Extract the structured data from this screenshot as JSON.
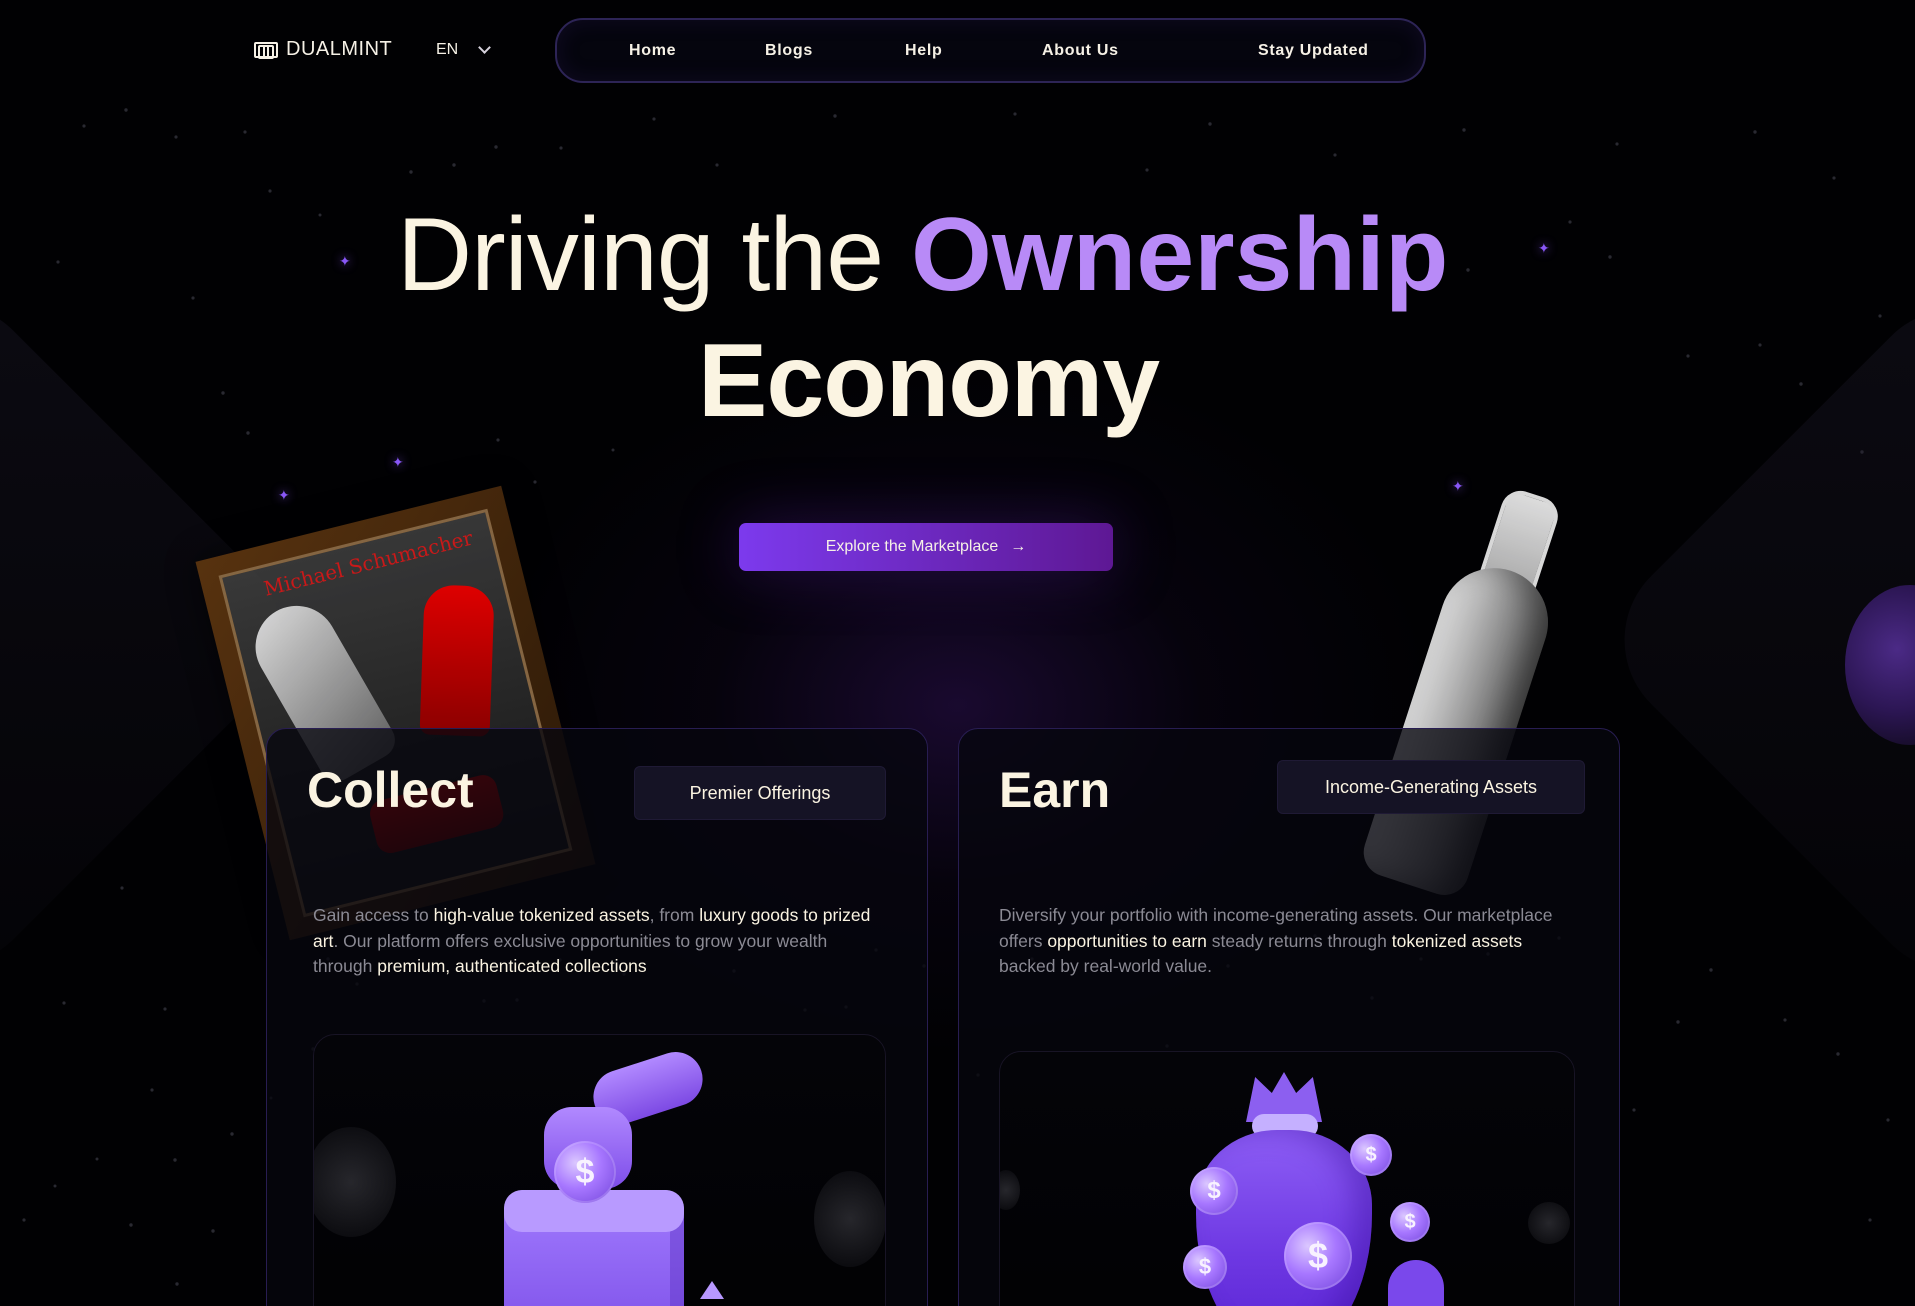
{
  "brand": {
    "name": "DUALMINT"
  },
  "language": {
    "selected": "EN"
  },
  "nav": {
    "items": [
      "Home",
      "Blogs",
      "Help",
      "About Us",
      "Stay Updated"
    ]
  },
  "hero": {
    "line1_prefix": "Driving the ",
    "line1_highlight": "Ownership",
    "line2": "Economy"
  },
  "cta": {
    "label": "Explore the Marketplace",
    "arrow": "→"
  },
  "showcase": {
    "frame_caption": "Michael Schumacher"
  },
  "cards": [
    {
      "title": "Collect",
      "pill": "Premier Offerings",
      "text": {
        "t1": "Gain access to ",
        "h1": "high-value tokenized assets",
        "t2": ", from ",
        "h2": "luxury goods to prized art",
        "t3": ". Our platform offers exclusive opportunities to grow your wealth through ",
        "h3": "premium, authenticated collections"
      }
    },
    {
      "title": "Earn",
      "pill": "Income-Generating Assets",
      "text": {
        "t1": "Diversify your portfolio with income-generating assets. Our marketplace offers ",
        "h1": "opportunities to earn",
        "t2": " steady returns through ",
        "h2": "tokenized assets",
        "t3": " backed by real-world value."
      }
    }
  ],
  "icons": {
    "logo": "dualmint-logo-icon",
    "chevron": "chevron-down-icon",
    "arrow": "arrow-right-icon",
    "sparkle": "sparkle-icon",
    "coin": "dollar-coin-icon"
  },
  "colors": {
    "background": "#010103",
    "accent": "#b88af7",
    "button_start": "#7c3aed",
    "button_end": "#5e1894",
    "text": "#f6f1e6"
  }
}
